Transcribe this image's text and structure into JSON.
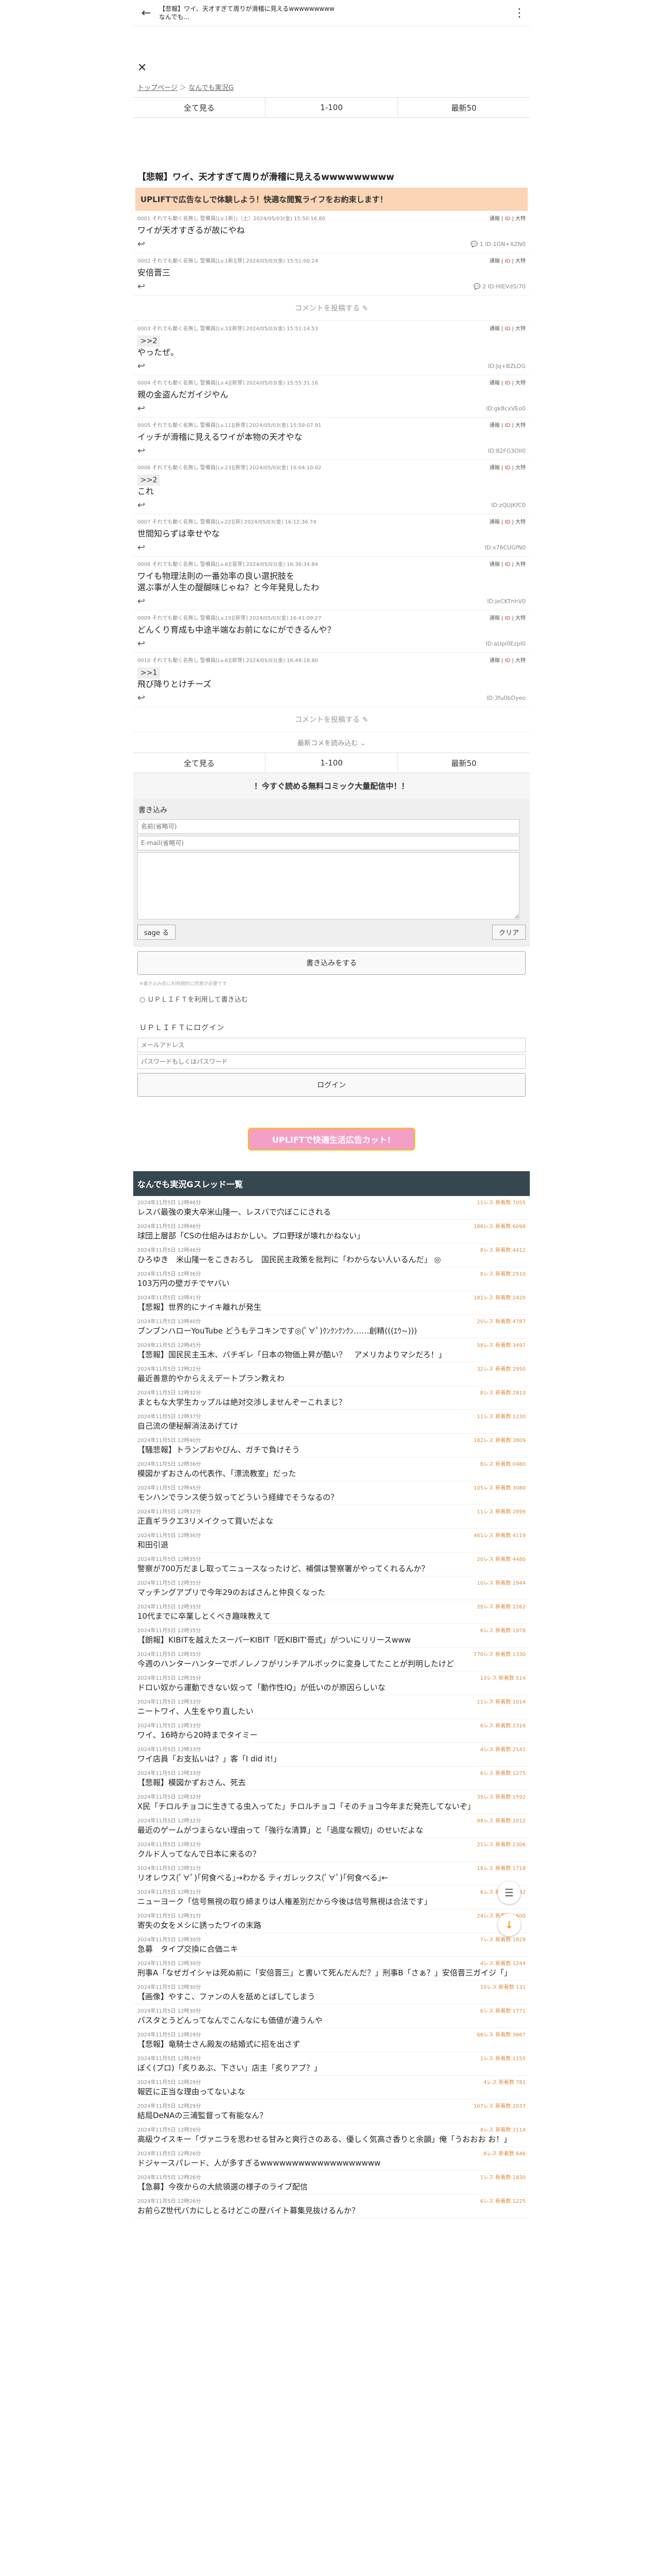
{
  "topbar": {
    "title": "【悲報】ワイ、天才すぎて周りが滑稽に見えるwwwwwwwww",
    "subtitle": "なんでも..."
  },
  "breadcrumb": {
    "home": "トップページ",
    "sep": "＞",
    "board": "なんでも実況G"
  },
  "pager": [
    "全て見る",
    "1-100",
    "最新50"
  ],
  "thread_title": "【悲報】ワイ、天才すぎて周りが滑稽に見えるwwwwwwwww",
  "ad_text": "UPLIFTで広告なしで体験しよう！快適な閲覧ライフをお約束します！",
  "tools": {
    "tsuhou": "通報",
    "nid": "ID",
    "res": "大特"
  },
  "posts": [
    {
      "meta": "0001 それでも動く名無し 警備員[Lv.1新]」（土）2024/05/03(金) 15:50:16.80",
      "body": "ワイが天才すぎるが故にやね",
      "id": "ID:1GN+XZN0",
      "replies": "1"
    },
    {
      "meta": "0002 それでも動く名無し 警備員[Lv.1新][芽] 2024/05/03(金) 15:51:00.24",
      "body": "安倍晋三",
      "id": "ID:HIEVd5/70",
      "replies": "2"
    },
    {
      "meta": "0003 それでも動く名無し 警備員[Lv.3][新芽] 2024/05/03(金) 15:51:14.53",
      "anchor": ">>2",
      "body": "やったぜ。",
      "id": "ID:Jq+BZLOG",
      "replies": ""
    },
    {
      "meta": "0004 それでも動く名無し 警備員[Lv.4][新芽] 2024/05/03(金) 15:55:31.16",
      "body": "親の金盗んだガイジやん",
      "id": "ID:gk8cxVEo0",
      "replies": ""
    },
    {
      "meta": "0005 それでも動く名無し 警備員[Lv.11][新芽] 2024/05/03(金) 15:59:07.91",
      "body": "イッチが滑稽に見えるワイが本物の天才やな",
      "id": "ID:82FG3Oll0",
      "replies": ""
    },
    {
      "meta": "0006 それでも動く名無し 警備員[Lv.23][新芽] 2024/05/03(金) 16:04:10.02",
      "anchor": ">>2",
      "body": "これ",
      "id": "ID:zQUjKfC0",
      "replies": ""
    },
    {
      "meta": "0007 それでも動く名無し 警備員[Lv.22][新] 2024/05/03(金) 16:12:36.74",
      "body": "世間知らずは幸せやな",
      "id": "ID:x76CUGfN0",
      "replies": ""
    },
    {
      "meta": "0008 それでも動く名無し 警備員[Lv.6][苗芽] 2024/05/03(金) 16:36:34.84",
      "body": "ワイも物理法則の一番効率の良い選択肢を\n選ぶ事が人生の醍醐味じゃね？と今年発見したわ",
      "id": "ID:jeCKTnhV0",
      "replies": ""
    },
    {
      "meta": "0009 それでも動く名無し 警備員[Lv.19][新芽] 2024/05/03(金) 16:41:09.27",
      "body": "どんくり育成も中途半端なお前になにができるんや？",
      "id": "ID:aUpi0EzpI0",
      "replies": ""
    },
    {
      "meta": "0010 それでも動く名無し 警備員[Lv.6][新芽] 2024/05/03(金) 16:49:18.80",
      "anchor": ">>1",
      "body": "飛び降りとけチーズ",
      "id": "ID:3fu0bDyeo",
      "replies": ""
    }
  ],
  "comment_btn": "コメントを投稿する",
  "latest_btn": "最新コメを読み込む",
  "comic": "！今すぐ読める無料コミック大量配信中！！",
  "form": {
    "title": "書き込み",
    "name_ph": "名前(省略可)",
    "mail_ph": "E-mail(省略可)",
    "sage": "sage る",
    "clear": "クリア",
    "submit": "書き込みをする",
    "note": "※書き込み前に利用規約に同意が必要です",
    "uplift": "ＵＰＬＩＦＴを利用して書き込む"
  },
  "login": {
    "title": "ＵＰＬＩＦＴにログイン",
    "mail_ph": "メールアドレス",
    "pass_ph": "パスワードもしくはパスワード",
    "button": "ログイン"
  },
  "banner": "UPLIFTで快適生活広告カット!",
  "section_title": "なんでも実況Gスレッド一覧",
  "threads": [
    {
      "d": "2024年11月5日 12時46分",
      "c": "11レス 新着数 7055",
      "t": "レスバ最強の東大卒米山隆一、レスバで穴ぼこにされる"
    },
    {
      "d": "2024年11月5日 12時46分",
      "c": "186レス 新着数 6098",
      "t": "球団上層部「CSの仕組みはおかしい。プロ野球が壊れかねない」"
    },
    {
      "d": "2024年11月5日 12時46分",
      "c": "8レス 新着数 4412",
      "t": "ひろゆき　米山隆一をこきおろし　国民民主政策を批判に「わからない人いるんだ」 ◎"
    },
    {
      "d": "2024年11月5日 12時36分",
      "c": "8レス 新着数 2510",
      "t": "103万円の壁ガチでヤバい"
    },
    {
      "d": "2024年11月5日 12時41分",
      "c": "181レス 新着数 2420",
      "t": "【悲報】世界的にナイキ離れが発生"
    },
    {
      "d": "2024年11月5日 12時40分",
      "c": "20レス 新着数 4787",
      "t": "ブンブンハローYouTube どうもテコキンです◎(ﾟ∀ﾟ)ｸﾝｸﾝｸﾝｸﾝ……創精(((ｴｳ~)))"
    },
    {
      "d": "2024年11月5日 12時45分",
      "c": "58レス 新着数 3497",
      "t": "【悲報】国民民主玉木、バチギレ「日本の物価上昇が酷い？　アメリカよりマシだろ！」"
    },
    {
      "d": "2024年11月5日 12時22分",
      "c": "32レス 新着数 2950",
      "t": "最近善意的やからええデートプラン教えわ"
    },
    {
      "d": "2024年11月5日 12時32分",
      "c": "8レス 新着数 2810",
      "t": "まともな大学生カップルは絶対交渉しませんぞーこれまじ？"
    },
    {
      "d": "2024年11月5日 12時37分",
      "c": "11レス 新着数 1230",
      "t": "自己流の便秘解消法あげてけ"
    },
    {
      "d": "2024年11月5日 12時40分",
      "c": "182レス 新着数 3809",
      "t": "【騒悲報】トランプおやびん、ガチで負けそう"
    },
    {
      "d": "2024年11月5日 12時36分",
      "c": "8レス 新着数 0480",
      "t": "模図かずおさんの代表作、「漂流教室」だった"
    },
    {
      "d": "2024年11月5日 12時45分",
      "c": "105レス 新着数 3080",
      "t": "モンハンでランス使う奴ってどういう経緯でそうなるの？"
    },
    {
      "d": "2024年11月5日 12時32分",
      "c": "11レス 新着数 2899",
      "t": "正直ギラクエ3リメイクって買いだよな"
    },
    {
      "d": "2024年11月5日 12時36分",
      "c": "461レス 新着数 4119",
      "t": "和田引退"
    },
    {
      "d": "2024年11月5日 12時35分",
      "c": "20レス 新着数 4480",
      "t": "警察が700万だまし取ってニュースなったけど、補償は警察署がやってくれるんか？"
    },
    {
      "d": "2024年11月5日 12時35分",
      "c": "10レス 新着数 1944",
      "t": "マッチングアプリで今年29のおばさんと仲良くなった"
    },
    {
      "d": "2024年11月5日 12時35分",
      "c": "28レス 新着数 2262",
      "t": "10代までに卒業しとくべき趣味教えて"
    },
    {
      "d": "2024年11月5日 12時35分",
      "c": "6レス 新着数 1978",
      "t": "【朗報】KIBITを越えたスーパーKIBIT「匠KIBIT'哥式」がついにリリースwww"
    },
    {
      "d": "2024年11月5日 12時35分",
      "c": "770レス 新着数 1330",
      "t": "今週のハンターハンターでボノレノフがリンチアルボックに変身してたことが判明したけど"
    },
    {
      "d": "2024年11月5日 12時35分",
      "c": "13レス 新着数 514",
      "t": "ドロい奴から運動できない奴って「動作性IQ」が低いのが原因らしいな"
    },
    {
      "d": "2024年11月5日 12時33分",
      "c": "11レス 新着数 1014",
      "t": "ニートワイ、人生をやり直したい"
    },
    {
      "d": "2024年11月5日 12時33分",
      "c": "6レス 新着数 2316",
      "t": "ワイ、16時から20時までタイミー"
    },
    {
      "d": "2024年11月5日 12時33分",
      "c": "4レス 新着数 2141",
      "t": "ワイ店員「お支払いは？」客「I did it!」"
    },
    {
      "d": "2024年11月5日 12時33分",
      "c": "6レス 新着数 1275",
      "t": "【悲報】模図かずおさん、死去"
    },
    {
      "d": "2024年11月5日 12時32分",
      "c": "39レス 新着数 1592",
      "t": "X民「チロルチョコに生きてる虫入ってた」チロルチョコ「そのチョコ今年まだ発売してないぞ」"
    },
    {
      "d": "2024年11月5日 12時32分",
      "c": "98レス 新着数 2012",
      "t": "最近のゲームがつまらない理由って「強行な清算」と「過度な親切」のせいだよな"
    },
    {
      "d": "2024年11月5日 12時32分",
      "c": "21レス 新着数 2306",
      "t": "クルド人ってなんで日本に来るの？"
    },
    {
      "d": "2024年11月5日 12時31分",
      "c": "18レス 新着数 1718",
      "t": "リオレウス(ﾟ∀ﾟ)｢何食べる｣→わかる ティガレックス(ﾟ∀ﾟ)｢何食べる｣←"
    },
    {
      "d": "2024年11月5日 12時31分",
      "c": "6レス 新着数 1242",
      "t": "ニューヨーク「信号無視の取り締まりは人権差別だから今後は信号無視は合法です」"
    },
    {
      "d": "2024年11月5日 12時31分",
      "c": "24レス 新着数 1600",
      "t": "寄失の女をメシに誘ったワイの末路"
    },
    {
      "d": "2024年11月5日 12時30分",
      "c": "7レス 新着数 1829",
      "t": "急募　タイプ交換に合価ニキ"
    },
    {
      "d": "2024年11月5日 12時30分",
      "c": "4レス 新着数 1244",
      "t": "刑事A「なぜガイシャは死ぬ前に「安倍晋三」と書いて死んだんだ？」刑事B「さぁ？」安倍晋三ガイジ「」"
    },
    {
      "d": "2024年11月5日 12時30分",
      "c": "10レス 新着数 131",
      "t": "【画像】やすこ、ファンの人を舐めとばしてしまう"
    },
    {
      "d": "2024年11月5日 12時30分",
      "c": "6レス 新着数 1771",
      "t": "パスタとうどんってなんでこんなにも価値が違うんや"
    },
    {
      "d": "2024年11月5日 12時29分",
      "c": "68レス 新着数 3667",
      "t": "【悲報】竜騎士さん殿友の結婚式に招を出さず"
    },
    {
      "d": "2024年11月5日 12時29分",
      "c": "1レス 新着数 1155",
      "t": "ぼく(プロ)「炙りあぶ、下さい」店主「炙りアブ？」"
    },
    {
      "d": "2024年11月5日 12時29分",
      "c": "4レス 新着数 781",
      "t": "報匠に正当な理由ってないよな"
    },
    {
      "d": "2024年11月5日 12時29分",
      "c": "107レス 新着数 2037",
      "t": "結局DeNAの三浦監督って有能なん？"
    },
    {
      "d": "2024年11月5日 12時28分",
      "c": "8レス 新着数 2114",
      "t": "高級ウイスキー「ヴァニラを思わせる甘みと爽行さのある、優しく気高さ香りと余韻」俺「うおおお お！」"
    },
    {
      "d": "2024年11月5日 12時26分",
      "c": "8レス 新着数 646",
      "t": "ドジャースパレード、人が多すぎるwwwwwwwwwwwwwwwwwww"
    },
    {
      "d": "2024年11月5日 12時26分",
      "c": "1レス 新着数 1830",
      "t": "【急募】今夜からの大統領選の様子のライブ配信"
    },
    {
      "d": "2024年11月5日 12時26分",
      "c": "6レス 新着数 1225",
      "t": "お前らZ世代バカにしとるけどこの歴バイト募集見抜けるんか？"
    }
  ]
}
